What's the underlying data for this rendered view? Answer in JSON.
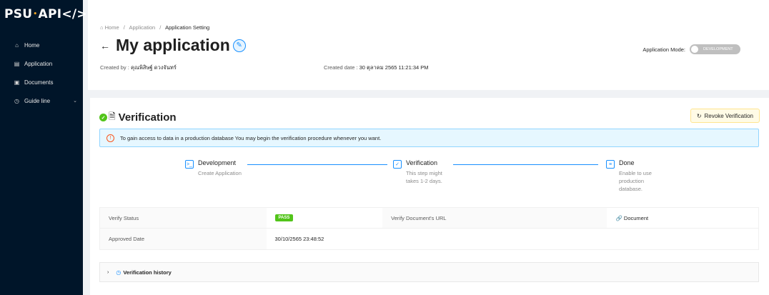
{
  "sidebar": {
    "logo": {
      "prefix": "PSU",
      "dot": "•",
      "suffix": "API</>"
    },
    "items": [
      {
        "label": "Home",
        "icon": "home-icon",
        "glyph": "⌂"
      },
      {
        "label": "Application",
        "icon": "app-icon",
        "glyph": "▤"
      },
      {
        "label": "Documents",
        "icon": "document-icon",
        "glyph": "▣"
      },
      {
        "label": "Guide line",
        "icon": "help-circle-icon",
        "glyph": "◷"
      }
    ]
  },
  "header": {
    "breadcrumb": {
      "home": "Home",
      "app": "Application",
      "current": "Application Setting",
      "sep": "/",
      "home_glyph": "⌂"
    },
    "back_glyph": "←",
    "title": "My application",
    "edit_glyph": "✎",
    "created_by_label": "Created by :",
    "created_by": "คุณพิสิษฐ์ ดวงจันทร์",
    "created_date_label": "Created date :",
    "created_date": "30 ตุลาคม 2565 11:21:34 PM",
    "mode_label": "Application Mode:",
    "mode_value": "DEVELOPMENT"
  },
  "verification": {
    "title": "Verification",
    "check_glyph": "✓",
    "doc_glyph": "🗎",
    "revoke_label": "Revoke Verification",
    "revoke_glyph": "↻",
    "alert_glyph": "!",
    "alert": "To gain access to data in a production database You may begin the verification procedure whenever you want.",
    "steps": [
      {
        "title": "Development",
        "desc": "Create Application",
        "icon": "terminal-icon",
        "glyph": ">_"
      },
      {
        "title": "Verification",
        "desc1": "This step might",
        "desc2": "takes 1-2 days.",
        "icon": "verify-doc-icon",
        "glyph": "✓"
      },
      {
        "title": "Done",
        "desc1": "Enable to use",
        "desc2": "production",
        "desc3": "database.",
        "icon": "done-doc-icon",
        "glyph": "≡"
      }
    ],
    "table": {
      "verify_status_label": "Verify Status",
      "verify_status": "PASS",
      "doc_url_label": "Verify Document's URL",
      "doc_link": "Document",
      "doc_glyph": "🔗",
      "approved_label": "Approved Date",
      "approved_date": "30/10/2565 23:48:52"
    },
    "history_label": "Verification history",
    "history_chev": "›",
    "history_glyph": "◷"
  },
  "colors": {
    "sidebar": "#001529",
    "primary": "#1890ff",
    "success": "#52c41a",
    "alert_bg": "#e6f7ff",
    "revoke_bg": "#fffbe6"
  }
}
